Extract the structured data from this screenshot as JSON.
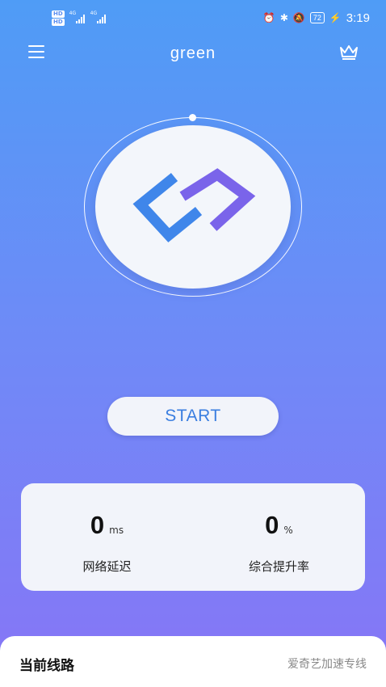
{
  "status_bar": {
    "hd1": "HD",
    "hd2": "HD",
    "net1": "4G",
    "net2": "4G",
    "battery": "72",
    "time": "3:19"
  },
  "header": {
    "title": "green"
  },
  "start_button": {
    "label": "START"
  },
  "stats": {
    "latency": {
      "value": "0",
      "unit": "ms",
      "label": "网络延迟"
    },
    "boost": {
      "value": "0",
      "unit": "%",
      "label": "综合提升率"
    }
  },
  "route": {
    "title": "当前线路",
    "value": "爱奇艺加速专线"
  },
  "colors": {
    "bg_top": "#4f9cf6",
    "bg_bottom": "#8775f6",
    "logo_blue": "#3f86ea",
    "logo_purple": "#7a64ea",
    "start_text": "#3a7ee0"
  }
}
